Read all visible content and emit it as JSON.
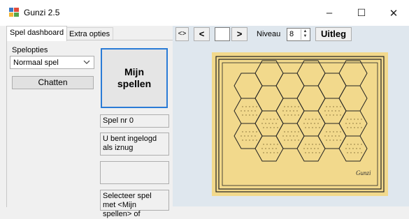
{
  "window": {
    "title": "Gunzi 2.5",
    "minimize": "–",
    "maximize": "☐",
    "close": "✕"
  },
  "tabs": [
    {
      "label": "Spel dashboard"
    },
    {
      "label": "Extra opties"
    }
  ],
  "options": {
    "label": "Spelopties",
    "selected": "Normaal spel",
    "chat_button": "Chatten"
  },
  "mijn_spellen": {
    "line1": "Mijn",
    "line2": "spellen"
  },
  "info": {
    "spel_nr": "Spel nr 0",
    "login": "U bent ingelogd als iznug",
    "empty": "",
    "instructie": "Selecteer spel met <Mijn spellen> of"
  },
  "toolbar": {
    "toggle": "<>",
    "prev": "<",
    "next": ">",
    "niveau_label": "Niveau",
    "niveau_value": "8",
    "uitleg": "Uitleg"
  },
  "board": {
    "signature": "Gunzi"
  },
  "colors": {
    "accent": "#2a7bd6",
    "board": "#f2d98c",
    "panel": "#dfe7ee"
  }
}
